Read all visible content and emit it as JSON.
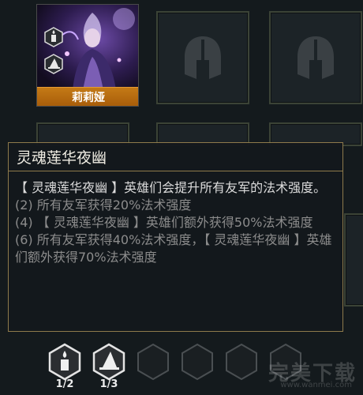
{
  "hero": {
    "name": "莉莉娅",
    "traits": [
      "candle-icon",
      "witch-hat-icon"
    ]
  },
  "tooltip": {
    "title": "灵魂莲华夜幽",
    "description": "【 灵魂莲华夜幽 】英雄们会提升所有友军的法术强度。",
    "tiers": [
      "(2) 所有友军获得20%法术强度",
      "(4) 【 灵魂莲华夜幽 】英雄们额外获得50%法术强度",
      "(6) 所有友军获得40%法术强度，【 灵魂莲华夜幽 】英雄们额外获得70%法术强度"
    ]
  },
  "synergies": [
    {
      "icon": "candle-icon",
      "count": "1/2",
      "active": true
    },
    {
      "icon": "witch-hat-icon",
      "count": "1/3",
      "active": true
    },
    {
      "icon": "empty-hex-icon",
      "count": "",
      "active": false
    },
    {
      "icon": "empty-hex-icon",
      "count": "",
      "active": false
    },
    {
      "icon": "empty-hex-icon",
      "count": "",
      "active": false
    },
    {
      "icon": "empty-hex-icon",
      "count": "",
      "active": false
    }
  ],
  "watermark": {
    "text": "完美下载",
    "sub": "www.wanmei.com"
  },
  "colors": {
    "name_bar": "#b86a10",
    "border_gold": "#8e7a4b",
    "slot_border": "#3b4336"
  }
}
